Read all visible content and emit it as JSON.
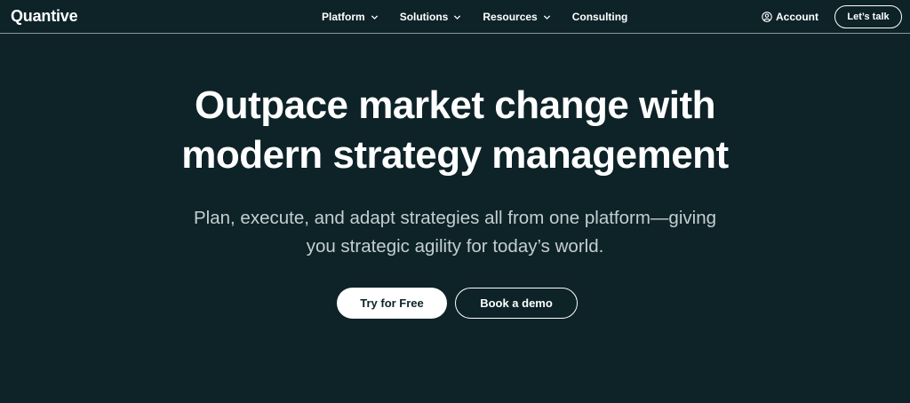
{
  "nav": {
    "logo": "Quantive",
    "items": [
      {
        "label": "Platform",
        "has_dropdown": true,
        "icon": "chevron-down-icon"
      },
      {
        "label": "Solutions",
        "has_dropdown": true,
        "icon": "chevron-down-icon"
      },
      {
        "label": "Resources",
        "has_dropdown": true,
        "icon": "chevron-down-icon"
      },
      {
        "label": "Consulting",
        "has_dropdown": false
      }
    ],
    "account": {
      "label": "Account",
      "icon": "user-circle-icon"
    },
    "cta": "Let’s talk"
  },
  "hero": {
    "title_line1": "Outpace market change with",
    "title_line2": "modern strategy management",
    "subtitle_line1": "Plan, execute, and adapt strategies all from one platform—giving",
    "subtitle_line2": "you strategic agility for today’s world.",
    "primary_cta": "Try for Free",
    "secondary_cta": "Book a demo"
  },
  "colors": {
    "background": "#0d2328",
    "text": "#ffffff",
    "subtext": "#c5cecf",
    "divider": "#8a9a9c"
  }
}
